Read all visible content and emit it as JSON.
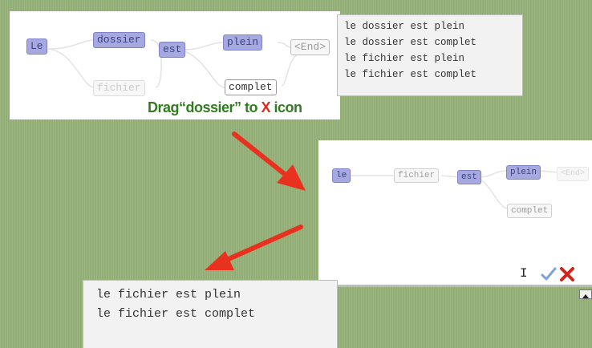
{
  "top_graph": {
    "nodes": {
      "le": "Le",
      "dossier": "dossier",
      "fichier": "fichier",
      "est": "est",
      "plein": "plein",
      "complet": "complet",
      "end": "<End>"
    },
    "output_lines": [
      "le dossier est plein",
      "le dossier est complet",
      "le fichier est plein",
      "le fichier est complet"
    ]
  },
  "caption": {
    "prefix": "Drag“dossier” to ",
    "x": "X",
    "suffix": " icon"
  },
  "bottom_graph": {
    "nodes": {
      "le": "le",
      "fichier": "fichier",
      "est": "est",
      "plein": "plein",
      "complet": "complet",
      "end": "<End>"
    },
    "tools": {
      "text_cursor": "I"
    }
  },
  "bottom_output": {
    "lines": [
      "le fichier est plein",
      "le fichier est complet"
    ]
  },
  "icons": {
    "check": "check-icon",
    "delete": "x-delete-icon",
    "collapse": "collapse-icon"
  },
  "colors": {
    "node_active": "#a5a9dd",
    "arrow": "#e8321f",
    "caption": "#2f7d1f",
    "caption_x": "#e12b1d"
  }
}
